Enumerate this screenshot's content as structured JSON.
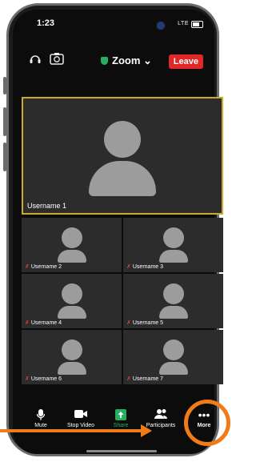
{
  "status": {
    "time": "1:23",
    "network": "LTE"
  },
  "header": {
    "title": "Zoom",
    "leave_label": "Leave"
  },
  "main_video": {
    "username": "Username 1"
  },
  "participants": [
    {
      "username": "Username 2"
    },
    {
      "username": "Username 3"
    },
    {
      "username": "Username 4"
    },
    {
      "username": "Username 5"
    },
    {
      "username": "Username 6"
    },
    {
      "username": "Username 7"
    }
  ],
  "toolbar": {
    "mute_label": "Mute",
    "stop_video_label": "Stop Video",
    "share_label": "Share",
    "participants_label": "Participants",
    "more_label": "More"
  },
  "colors": {
    "leave": "#e02828",
    "active_speaker_border": "#c9ac2a",
    "share": "#27ae60",
    "annotation": "#ef7c18"
  }
}
